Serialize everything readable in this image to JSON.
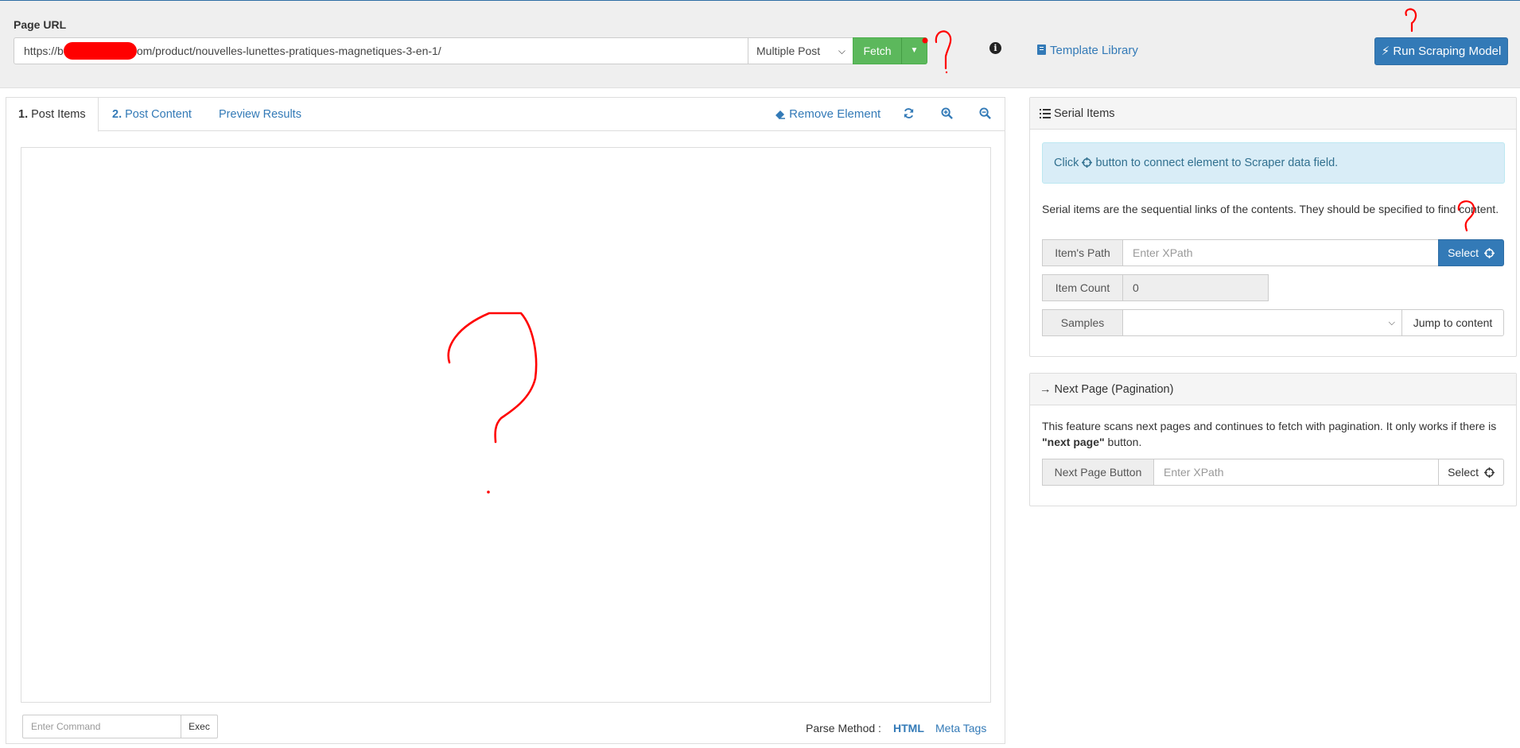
{
  "toolbar": {
    "url_label": "Page URL",
    "url_value_start": "https://b",
    "url_value_end": "om/product/nouvelles-lunettes-pratiques-magnetiques-3-en-1/",
    "mode_select": "Multiple Post",
    "fetch_label": "Fetch",
    "info_glyph": "i",
    "template_library": "Template Library",
    "run_label": "Run Scraping Model"
  },
  "tabs": [
    {
      "num": "1.",
      "label": "Post Items"
    },
    {
      "num": "2.",
      "label": "Post Content"
    },
    {
      "num": "",
      "label": "Preview Results"
    }
  ],
  "tools": {
    "remove_element": "Remove Element"
  },
  "command": {
    "placeholder": "Enter Command",
    "exec_label": "Exec"
  },
  "parse": {
    "label": "Parse Method :",
    "html": "HTML",
    "meta": "Meta Tags"
  },
  "serial": {
    "title": "Serial Items",
    "alert_pre": "Click",
    "alert_post": "button to connect element to Scraper data field.",
    "description": "Serial items are the sequential links of the contents. They should be specified to find content.",
    "path_label": "Item's Path",
    "path_placeholder": "Enter XPath",
    "select_label": "Select",
    "count_label": "Item Count",
    "count_value": "0",
    "samples_label": "Samples",
    "jump_label": "Jump to content"
  },
  "pagination": {
    "title": "Next Page (Pagination)",
    "desc_pre": "This feature scans next pages and continues to fetch with pagination. It only works if there is ",
    "desc_bold": "\"next page\"",
    "desc_post": " button.",
    "button_label": "Next Page Button",
    "placeholder": "Enter XPath",
    "select_label": "Select"
  },
  "colors": {
    "primary": "#337ab7",
    "success": "#5cb85c",
    "alert_bg": "#d9edf7",
    "annotation": "#ff0000"
  }
}
